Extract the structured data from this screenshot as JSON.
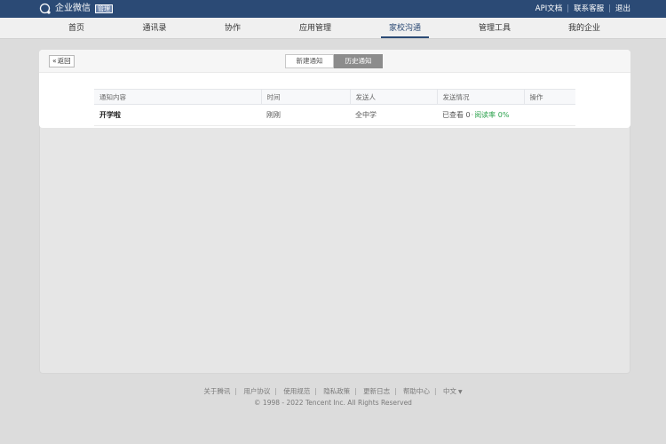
{
  "topbar": {
    "logo_text": "企业微信",
    "logo_badge": "管理",
    "links": [
      "API文档",
      "联系客服",
      "退出"
    ]
  },
  "nav": {
    "items": [
      "首页",
      "通讯录",
      "协作",
      "应用管理",
      "家校沟通",
      "管理工具",
      "我的企业"
    ],
    "active": "家校沟通"
  },
  "toolbar": {
    "back_label": "返回",
    "tabs": [
      "新建通知",
      "历史通知"
    ],
    "active_tab": "历史通知"
  },
  "table": {
    "headers": [
      "通知内容",
      "时间",
      "发送人",
      "发送情况",
      "操作"
    ],
    "rows": [
      {
        "content": "开学啦",
        "time": "刚刚",
        "sender": "全中学",
        "viewed": "已查看 0",
        "read_rate": "阅读率 0%",
        "action": ""
      }
    ]
  },
  "footer": {
    "links": [
      "关于腾讯",
      "用户协议",
      "使用规范",
      "隐私政策",
      "更新日志",
      "帮助中心"
    ],
    "language": "中文",
    "copyright": "© 1998 - 2022 Tencent Inc. All Rights Reserved"
  },
  "colors": {
    "topbar": "#2b4a75",
    "read_rate": "#2aa14b",
    "active_tab": "#8c8c8c"
  }
}
